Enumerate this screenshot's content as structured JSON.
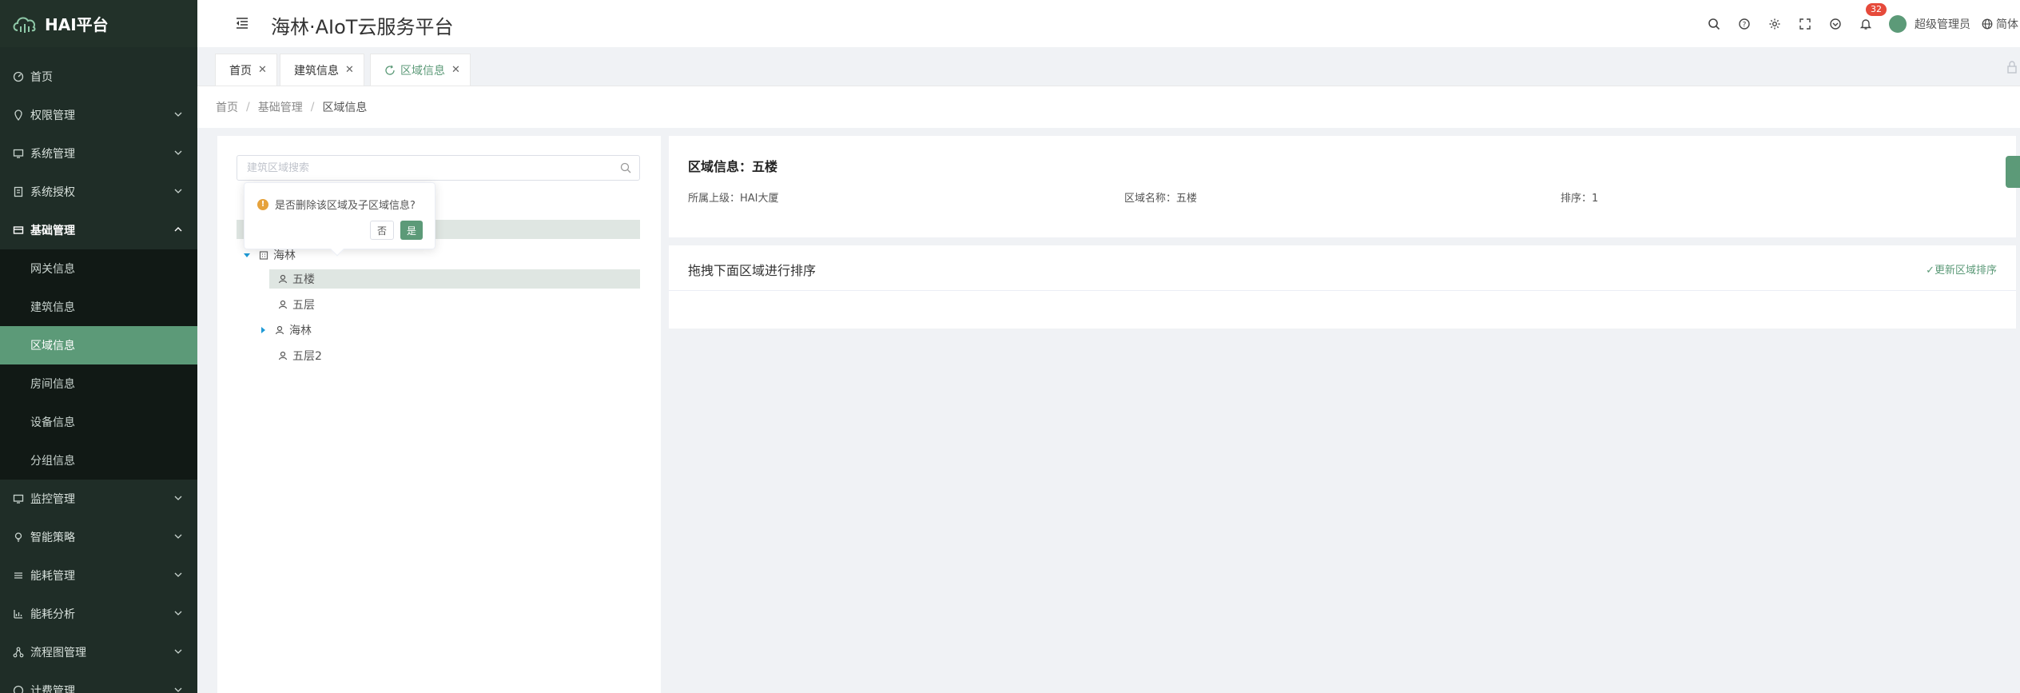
{
  "app": {
    "brand": "HAI平台",
    "title": "海林·AIoT云服务平台"
  },
  "header": {
    "notification_count": "32",
    "user_name": "超级管理员",
    "language": "简体"
  },
  "sidebar": {
    "items": [
      {
        "label": "首页"
      },
      {
        "label": "权限管理"
      },
      {
        "label": "系统管理"
      },
      {
        "label": "系统授权"
      },
      {
        "label": "基础管理"
      }
    ],
    "submenu": [
      {
        "label": "网关信息"
      },
      {
        "label": "建筑信息"
      },
      {
        "label": "区域信息"
      },
      {
        "label": "房间信息"
      },
      {
        "label": "设备信息"
      },
      {
        "label": "分组信息"
      }
    ],
    "items_after": [
      {
        "label": "监控管理"
      },
      {
        "label": "智能策略"
      },
      {
        "label": "能耗管理"
      },
      {
        "label": "能耗分析"
      },
      {
        "label": "流程图管理"
      },
      {
        "label": "计费管理"
      }
    ]
  },
  "tabs": [
    {
      "label": "首页"
    },
    {
      "label": "建筑信息"
    },
    {
      "label": "区域信息"
    }
  ],
  "breadcrumb": [
    "首页",
    "基础管理",
    "区域信息"
  ],
  "tree": {
    "search_placeholder": "建筑区域搜索",
    "nodes": [
      {
        "label": "海林"
      },
      {
        "label": "五楼"
      },
      {
        "label": "五层"
      },
      {
        "label": "海林"
      },
      {
        "label": "五层2"
      }
    ]
  },
  "popconfirm": {
    "message": "是否删除该区域及子区域信息?",
    "no_label": "否",
    "yes_label": "是"
  },
  "detail": {
    "title": "区域信息：五楼",
    "parent": "所属上级：HAI大厦",
    "name": "区域名称：五楼",
    "order": "排序：1"
  },
  "sort_card": {
    "title": "拖拽下面区域进行排序",
    "action": "更新区域排序"
  },
  "colors": {
    "accent": "#5c9a78",
    "sidebar_bg": "#1f2d27",
    "badge": "#e64a3b",
    "warning": "#e6a23c"
  }
}
